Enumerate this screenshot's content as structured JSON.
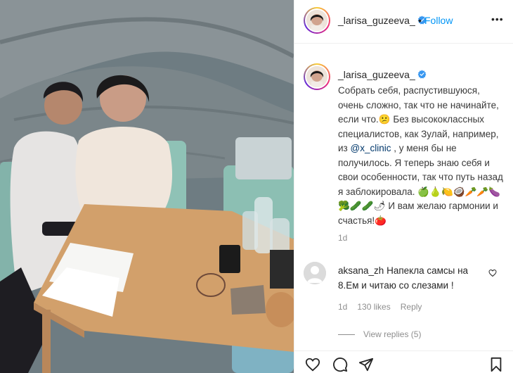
{
  "post": {
    "username": "_larisa_guzeeva_",
    "dot": "•",
    "follow_label": "Follow",
    "more_label": "•••",
    "caption_username": "_larisa_guzeeva_",
    "caption_part1": "Собрать себя, распустившуюся, очень сложно, так что не начинайте, если что.",
    "caption_emoji1": "😕",
    "caption_part2": " Без высококлассных специалистов, как Зулай, например, из ",
    "caption_mention": "@x_clinic",
    "caption_part3": " , у меня бы не получилось. Я теперь знаю себя и свои особенности, так что путь назад я заблокировала.",
    "caption_emoji2": "🍏🍐🍋🥥🥕🥕🍆🥦🥒🥒🌶",
    "caption_part4": " И вам желаю гармонии и счастья!",
    "caption_emoji3": "🍅",
    "caption_time": "1d"
  },
  "comment": {
    "username": "aksana_zh",
    "text": "Напекла самсы на 8.Ем и читаю со слезами !",
    "time": "1d",
    "likes": "130 likes",
    "reply_label": "Reply",
    "view_replies": "View replies (5)"
  },
  "icons": {
    "verified": "verified-badge-icon",
    "heart": "heart-icon",
    "comment": "comment-icon",
    "share": "share-icon",
    "save": "bookmark-icon"
  },
  "colors": {
    "link": "#0095f6",
    "mention": "#00376b",
    "muted": "#8e8e8e",
    "verified": "#3897f0"
  }
}
